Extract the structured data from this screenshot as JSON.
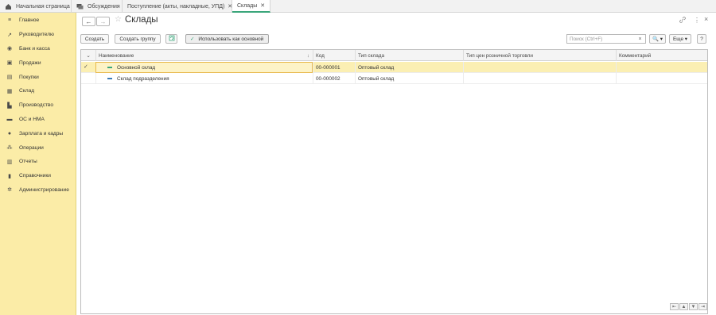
{
  "tabs": [
    {
      "label": "Начальная страница",
      "icon": "home-icon"
    },
    {
      "label": "Обсуждения",
      "icon": "chat-icon"
    },
    {
      "label": "Поступление (акты, накладные, УПД)",
      "icon": ""
    },
    {
      "label": "Склады",
      "icon": ""
    }
  ],
  "sidebar": {
    "items": [
      {
        "label": "Главное",
        "icon": "menu-icon"
      },
      {
        "label": "Руководителю",
        "icon": "trend-icon"
      },
      {
        "label": "Банк и касса",
        "icon": "bank-icon"
      },
      {
        "label": "Продажи",
        "icon": "bag-icon"
      },
      {
        "label": "Покупки",
        "icon": "cart-icon"
      },
      {
        "label": "Склад",
        "icon": "warehouse-icon"
      },
      {
        "label": "Производство",
        "icon": "factory-icon"
      },
      {
        "label": "ОС и НМА",
        "icon": "assets-icon"
      },
      {
        "label": "Зарплата и кадры",
        "icon": "person-icon"
      },
      {
        "label": "Операции",
        "icon": "operations-icon"
      },
      {
        "label": "Отчеты",
        "icon": "chart-icon"
      },
      {
        "label": "Справочники",
        "icon": "book-icon"
      },
      {
        "label": "Администрирование",
        "icon": "gear-icon"
      }
    ]
  },
  "header": {
    "title": "Склады",
    "back": "←",
    "forward": "→",
    "star": "☆",
    "link": "🔗",
    "more": "⋮",
    "close": "×"
  },
  "toolbar": {
    "create": "Создать",
    "create_group": "Создать группу",
    "use_default": "Использовать как основной",
    "search_placeholder": "Поиск (Ctrl+F)",
    "search_clear": "×",
    "search_btn": "🔍 ▾",
    "more": "Еще ▾",
    "help": "?"
  },
  "table": {
    "columns": [
      "Наименование",
      "Код",
      "Тип склада",
      "Тип цен розничной торговли",
      "Комментарий"
    ],
    "sort_mark": "↓",
    "rows": [
      {
        "name": "Основной склад",
        "code": "00-000001",
        "type": "Оптовый склад",
        "price_type": "",
        "comment": "",
        "selected": true,
        "check": "✓",
        "dash_color": "#3aa57a"
      },
      {
        "name": "Склад подразделения",
        "code": "00-000002",
        "type": "Оптовый склад",
        "price_type": "",
        "comment": "",
        "selected": false,
        "check": "",
        "dash_color": "#3a7ab5"
      }
    ]
  },
  "pagination": [
    "⇤",
    "▲",
    "▼",
    "⇥"
  ],
  "colors": {
    "accent": "#3aa57a",
    "sidebar": "#fbeca7",
    "selected_row": "#fbefb3"
  }
}
